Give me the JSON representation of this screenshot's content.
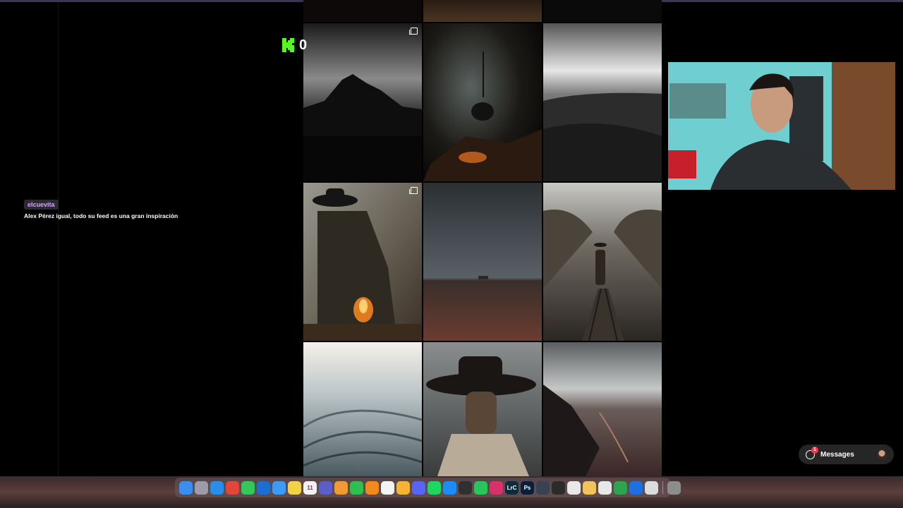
{
  "kick": {
    "count": "0",
    "brand_color": "#53fc18"
  },
  "chat": {
    "username": "elcuevita",
    "message": "Alex Pérez igual, todo su feed es una gran inspiración",
    "username_color": "#d9a3ff"
  },
  "feed": {
    "tiles": [
      {
        "subject": "moody-mountain-landscape",
        "multi": true
      },
      {
        "subject": "kettle-over-campfire",
        "multi": false
      },
      {
        "subject": "rocky-plateau",
        "multi": false
      },
      {
        "subject": "cowboy-at-campfire",
        "multi": true
      },
      {
        "subject": "lonely-field-horizon",
        "multi": false
      },
      {
        "subject": "cowboy-on-railway",
        "multi": false
      },
      {
        "subject": "aerial-snow-ridges",
        "multi": false
      },
      {
        "subject": "cowboy-portrait",
        "multi": false
      },
      {
        "subject": "aerial-mountain-valley",
        "multi": false
      }
    ]
  },
  "messages": {
    "label": "Messages",
    "badge": "1"
  },
  "dock": {
    "apps": [
      {
        "name": "finder",
        "color": "#3d8cf0",
        "label": ""
      },
      {
        "name": "launchpad",
        "color": "#9c9ca8",
        "label": ""
      },
      {
        "name": "safari",
        "color": "#2a8de8",
        "label": ""
      },
      {
        "name": "chrome",
        "color": "#e0463a",
        "label": ""
      },
      {
        "name": "messages",
        "color": "#34c759",
        "label": ""
      },
      {
        "name": "outlook",
        "color": "#1a6fd1",
        "label": ""
      },
      {
        "name": "mail",
        "color": "#3b9bf5",
        "label": ""
      },
      {
        "name": "notes",
        "color": "#f3d146",
        "label": ""
      },
      {
        "name": "calendar",
        "color": "#f2f2f2",
        "label": "11"
      },
      {
        "name": "teams",
        "color": "#5b5fc7",
        "label": ""
      },
      {
        "name": "photos",
        "color": "#f09a36",
        "label": ""
      },
      {
        "name": "facetime",
        "color": "#2fbf4e",
        "label": ""
      },
      {
        "name": "books",
        "color": "#f08a1f",
        "label": ""
      },
      {
        "name": "pages",
        "color": "#f4f4f4",
        "label": ""
      },
      {
        "name": "sketch",
        "color": "#f4b534",
        "label": ""
      },
      {
        "name": "discord",
        "color": "#5865f2",
        "label": ""
      },
      {
        "name": "spotify",
        "color": "#1ed760",
        "label": ""
      },
      {
        "name": "app-store",
        "color": "#1e8cf5",
        "label": ""
      },
      {
        "name": "obs",
        "color": "#303030",
        "label": ""
      },
      {
        "name": "whatsapp",
        "color": "#29c45a",
        "label": ""
      },
      {
        "name": "instagram",
        "color": "#d6336c",
        "label": ""
      },
      {
        "name": "lightroom-classic",
        "color": "#0e2a3d",
        "label": "LrC"
      },
      {
        "name": "photoshop",
        "color": "#0a1e3a",
        "label": "Ps"
      },
      {
        "name": "davinci-resolve",
        "color": "#384252",
        "label": ""
      },
      {
        "name": "activity-monitor",
        "color": "#2b2b2b",
        "label": ""
      },
      {
        "name": "keynote",
        "color": "#e9e9e9",
        "label": ""
      },
      {
        "name": "preview",
        "color": "#f0c45a",
        "label": ""
      },
      {
        "name": "capcut",
        "color": "#e8e8e8",
        "label": ""
      },
      {
        "name": "numbers",
        "color": "#2ea44f",
        "label": ""
      },
      {
        "name": "vpn",
        "color": "#1f6fe0",
        "label": ""
      },
      {
        "name": "screen-sharing",
        "color": "#dcdcdc",
        "label": ""
      },
      {
        "name": "trash",
        "color": "#8c8c8c",
        "label": ""
      }
    ]
  }
}
